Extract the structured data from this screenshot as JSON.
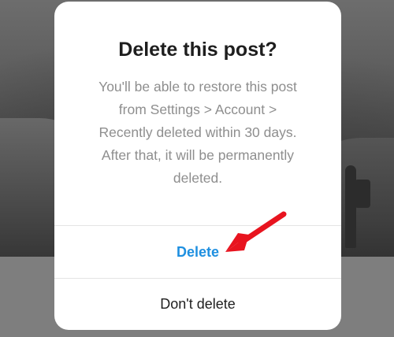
{
  "dialog": {
    "title": "Delete this post?",
    "message": "You'll be able to restore this post from Settings > Account > Recently deleted within 30 days. After that, it will be permanently deleted.",
    "delete_label": "Delete",
    "dont_delete_label": "Don't delete"
  },
  "colors": {
    "delete_accent": "#1e8fe0",
    "arrow": "#e8141f",
    "overlay": "#7e7e7e"
  },
  "annotation": {
    "icon": "red-arrow-pointer-icon"
  }
}
